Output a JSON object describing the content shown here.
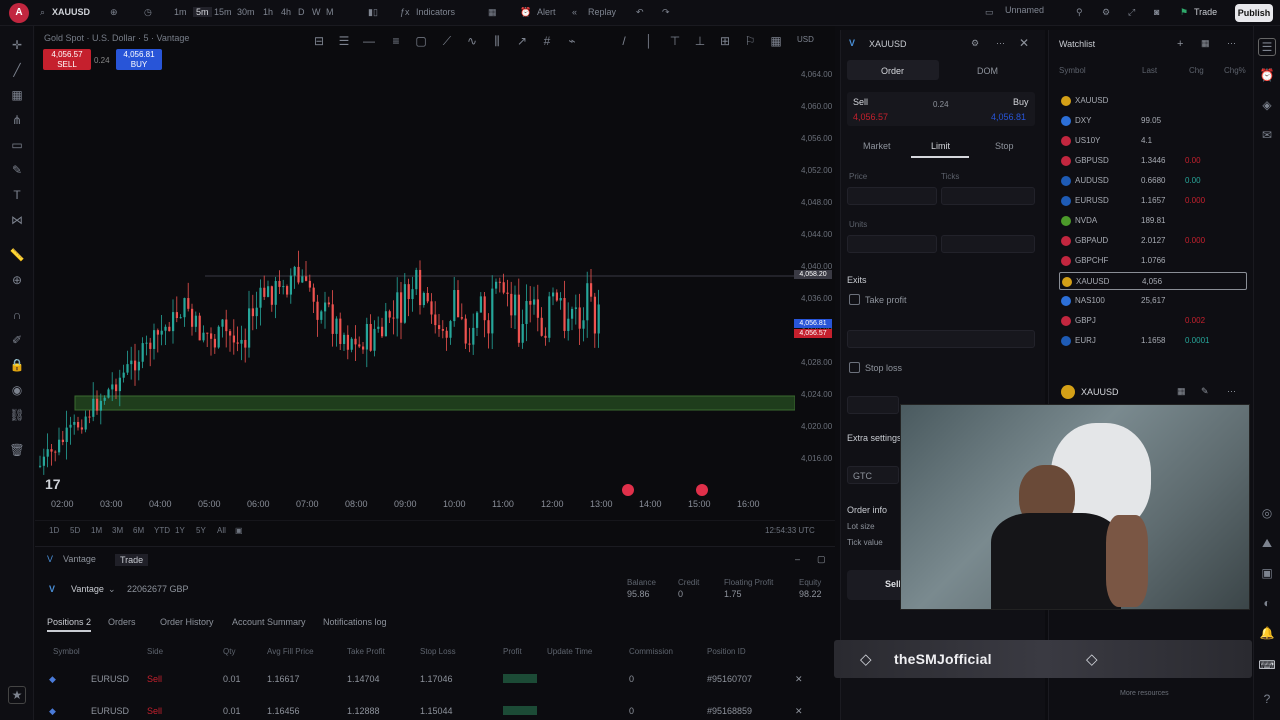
{
  "topbar": {
    "avatar_letter": "A",
    "symbol": "XAUUSD",
    "timeframes": [
      "1m",
      "5m",
      "15m",
      "30m",
      "1h",
      "4h",
      "D",
      "W",
      "M"
    ],
    "indicators_label": "Indicators",
    "alert_label": "Alert",
    "replay_label": "Replay",
    "layout_name": "Unnamed",
    "trade_label": "Trade",
    "publish_label": "Publish"
  },
  "chart": {
    "legend": "Gold Spot · U.S. Dollar · 5 · Vantage",
    "sell_price": "4,056.57",
    "sell_label": "SELL",
    "buy_price": "4,056.81",
    "buy_label": "BUY",
    "spread": "0.24",
    "x_ticks": [
      "02:00",
      "03:00",
      "04:00",
      "05:00",
      "06:00",
      "07:00",
      "08:00",
      "09:00",
      "10:00",
      "11:00",
      "12:00",
      "13:00",
      "14:00",
      "15:00",
      "16:00"
    ],
    "y_ticks": [
      "4,064.00",
      "4,060.00",
      "4,056.00",
      "4,052.00",
      "4,048.00",
      "4,044.00",
      "4,040.00",
      "4,036.00",
      "4,032.00",
      "4,028.00",
      "4,024.00",
      "4,020.00",
      "4,016.00"
    ],
    "price_tags": [
      "4,058.20",
      "4,056.81",
      "4,056.57"
    ],
    "ranges": [
      "1D",
      "5D",
      "1M",
      "3M",
      "6M",
      "YTD",
      "1Y",
      "5Y",
      "All"
    ],
    "clock": "12:54:33 UTC",
    "colors": {
      "up": "#26a69a",
      "down": "#ef5350",
      "zone": "#1f3d1c"
    }
  },
  "panel": {
    "tabs": [
      "Vantage",
      "Trade"
    ],
    "broker": "Vantage",
    "account": "22062677 GBP",
    "stats": [
      {
        "label": "Balance",
        "value": "95.86"
      },
      {
        "label": "Credit",
        "value": "0"
      },
      {
        "label": "Floating Profit",
        "value": "1.75"
      },
      {
        "label": "Equity",
        "value": "98.22"
      }
    ],
    "subtabs": [
      "Positions 2",
      "Orders",
      "Order History",
      "Account Summary",
      "Notifications log"
    ],
    "columns": [
      "Symbol",
      "Side",
      "Qty",
      "Avg Fill Price",
      "Take Profit",
      "Stop Loss",
      "Profit",
      "Update Time",
      "Commission",
      "Position ID"
    ],
    "rows": [
      {
        "symbol": "EURUSD",
        "side": "Sell",
        "qty": "0.01",
        "avg": "1.16617",
        "tp": "1.14704",
        "sl": "1.17046",
        "profit": "",
        "commission": "0",
        "id": "#95160707"
      },
      {
        "symbol": "EURUSD",
        "side": "Sell",
        "qty": "0.01",
        "avg": "1.16456",
        "tp": "1.12888",
        "sl": "1.15044",
        "profit": "",
        "commission": "0",
        "id": "#95168859"
      }
    ]
  },
  "order": {
    "symbol": "XAUUSD",
    "tabs": [
      "Order",
      "DOM"
    ],
    "sell_label": "Sell",
    "buy_label": "Buy",
    "sell_price": "4,056.57",
    "buy_price": "4,056.81",
    "spread": "0.24",
    "types": [
      "Market",
      "Limit",
      "Stop"
    ],
    "price_label": "Price",
    "ticks_label": "Ticks",
    "units_label": "Units",
    "exits_label": "Exits",
    "take_profit_label": "Take profit",
    "stop_loss_label": "Stop loss",
    "extra_settings_label": "Extra settings",
    "tif": "GTC",
    "order_info_label": "Order info",
    "lot_size_label": "Lot size",
    "tick_value_label": "Tick value",
    "submit_label": "Sell"
  },
  "watchlist": {
    "title": "Watchlist",
    "cols": [
      "Symbol",
      "Last",
      "Chg",
      "Chg%"
    ],
    "items": [
      {
        "sym": "XAUUSD",
        "last": "",
        "chg": "",
        "pct": "",
        "color": "#d4a017"
      },
      {
        "sym": "DXY",
        "last": "99.05",
        "chg": "",
        "pct": "",
        "color": "#2c6fd8"
      },
      {
        "sym": "US10Y",
        "last": "4.1",
        "chg": "",
        "pct": "",
        "color": "#c2263f"
      },
      {
        "sym": "GBPUSD",
        "last": "1.3446",
        "chg": "0.00",
        "pct": "",
        "color": "#c2263f"
      },
      {
        "sym": "AUDUSD",
        "last": "0.6680",
        "chg": "0.00",
        "pct": "",
        "color": "#1e5bb5"
      },
      {
        "sym": "EURUSD",
        "last": "1.1657",
        "chg": "0.000",
        "pct": "",
        "color": "#1e5bb5"
      },
      {
        "sym": "NVDA",
        "last": "189.81",
        "chg": "",
        "pct": "",
        "color": "#4c9a2a"
      },
      {
        "sym": "GBPAUD",
        "last": "2.0127",
        "chg": "0.000",
        "pct": "",
        "color": "#c2263f"
      },
      {
        "sym": "GBPCHF",
        "last": "1.0766",
        "chg": "",
        "pct": "",
        "color": "#c2263f"
      },
      {
        "sym": "XAUUSD",
        "last": "4,056",
        "chg": "",
        "pct": "",
        "color": "#d4a017"
      },
      {
        "sym": "NAS100",
        "last": "25,617",
        "chg": "",
        "pct": "",
        "color": "#2c6fd8"
      },
      {
        "sym": "GBPJ",
        "last": "",
        "chg": "0.002",
        "pct": "",
        "color": "#c2263f"
      },
      {
        "sym": "EURJ",
        "last": "1.1658",
        "chg": "0.0001",
        "pct": "",
        "color": "#1e5bb5"
      }
    ],
    "detail_symbol": "XAUUSD"
  },
  "stream": {
    "name": "theSMJofficial",
    "more": "More resources"
  }
}
